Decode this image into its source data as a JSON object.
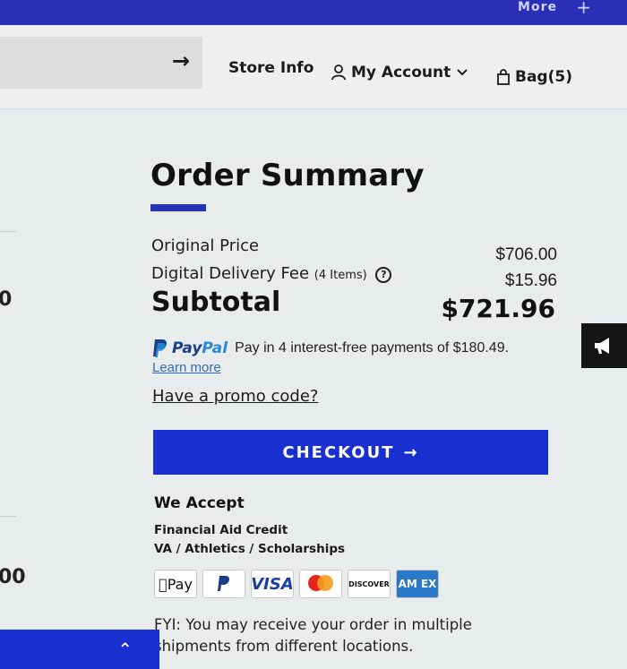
{
  "top": {
    "more": "More",
    "plus": "+"
  },
  "header": {
    "store_info": "Store Info",
    "my_account": "My Account",
    "bag": "Bag(5)"
  },
  "left": {
    "value1": "0",
    "value2": "00"
  },
  "summary": {
    "title": "Order Summary",
    "original_price_label": "Original Price",
    "original_price_value": "$706.00",
    "delivery_label": "Digital Delivery Fee",
    "delivery_items": "(4 Items)",
    "delivery_value": "$15.96",
    "subtotal_label": "Subtotal",
    "subtotal_value": "$721.96"
  },
  "paypal": {
    "brand_a": "Pay",
    "brand_b": "Pal",
    "message": "Pay in 4 interest-free payments of $180.49.",
    "learn_more": "Learn more"
  },
  "promo": "Have a promo code?",
  "checkout": "CHECKOUT",
  "accept": {
    "title": "We Accept",
    "line1": "Financial Aid Credit",
    "line2": "VA / Athletics / Scholarships",
    "cards": [
      "Pay",
      "PayPal",
      "VISA",
      "mastercard",
      "DISCOVER",
      "AM EX"
    ]
  },
  "fyi": "FYI: You may receive your order in multiple shipments from different locations.",
  "colors": {
    "brand_blue": "#1a2fcf",
    "paypal_dark": "#1a3e8a",
    "paypal_light": "#2a8ad3"
  }
}
